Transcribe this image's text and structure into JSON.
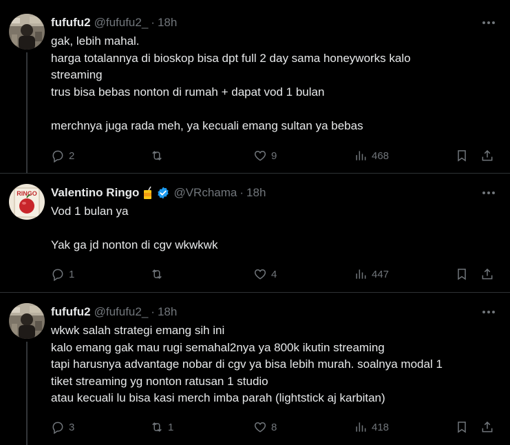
{
  "tweets": [
    {
      "name": "fufufu2",
      "handle": "@fufufu2_",
      "dot": "·",
      "time": "18h",
      "lines": [
        "gak, lebih mahal.",
        "harga totalannya di bioskop bisa dpt full 2 day sama honeyworks kalo",
        "streaming",
        "trus bisa bebas nonton di rumah + dapat vod 1 bulan",
        "",
        "merchnya juga rada meh, ya kecuali emang sultan ya bebas"
      ],
      "replies": "2",
      "retweets": "",
      "likes": "9",
      "views": "468"
    },
    {
      "name": "Valentino Ringo",
      "emoji": "🧃",
      "handle": "@VRchama",
      "dot": "·",
      "time": "18h",
      "lines": [
        "Vod 1 bulan ya",
        "",
        "Yak ga jd nonton di cgv wkwkwk"
      ],
      "replies": "1",
      "retweets": "",
      "likes": "4",
      "views": "447"
    },
    {
      "name": "fufufu2",
      "handle": "@fufufu2_",
      "dot": "·",
      "time": "18h",
      "lines": [
        "wkwk salah strategi emang sih ini",
        "kalo emang gak mau rugi semahal2nya ya 800k ikutin streaming",
        "tapi harusnya advantage nobar di cgv ya bisa lebih murah. soalnya modal 1",
        "tiket streaming yg nonton ratusan 1 studio",
        "atau kecuali lu bisa kasi merch imba parah (lightstick aj karbitan)"
      ],
      "replies": "3",
      "retweets": "1",
      "likes": "8",
      "views": "418"
    }
  ],
  "icons": {
    "more": "more-horizontal-icon",
    "reply": "reply-bubble-icon",
    "retweet": "retweet-icon",
    "like": "heart-icon",
    "views": "bar-chart-icon",
    "bookmark": "bookmark-icon",
    "share": "share-upload-icon",
    "verified": "verified-badge-icon"
  },
  "colors": {
    "background": "#000000",
    "text": "#e7e9ea",
    "muted": "#71767b",
    "divider": "#2f3336",
    "verified": "#1d9bf0"
  }
}
